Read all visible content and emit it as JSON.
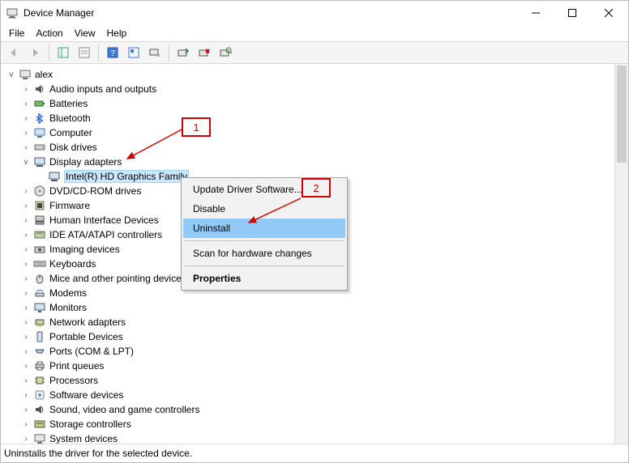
{
  "window": {
    "title": "Device Manager"
  },
  "menubar": {
    "items": [
      "File",
      "Action",
      "View",
      "Help"
    ]
  },
  "root": {
    "label": "alex"
  },
  "tree": [
    {
      "label": "Audio inputs and outputs"
    },
    {
      "label": "Batteries"
    },
    {
      "label": "Bluetooth"
    },
    {
      "label": "Computer"
    },
    {
      "label": "Disk drives"
    },
    {
      "label": "Display adapters"
    },
    {
      "label": "Intel(R) HD Graphics Family"
    },
    {
      "label": "DVD/CD-ROM drives"
    },
    {
      "label": "Firmware"
    },
    {
      "label": "Human Interface Devices"
    },
    {
      "label": "IDE ATA/ATAPI controllers"
    },
    {
      "label": "Imaging devices"
    },
    {
      "label": "Keyboards"
    },
    {
      "label": "Mice and other pointing devices"
    },
    {
      "label": "Modems"
    },
    {
      "label": "Monitors"
    },
    {
      "label": "Network adapters"
    },
    {
      "label": "Portable Devices"
    },
    {
      "label": "Ports (COM & LPT)"
    },
    {
      "label": "Print queues"
    },
    {
      "label": "Processors"
    },
    {
      "label": "Software devices"
    },
    {
      "label": "Sound, video and game controllers"
    },
    {
      "label": "Storage controllers"
    },
    {
      "label": "System devices"
    }
  ],
  "ctx": {
    "update": "Update Driver Software...",
    "disable": "Disable",
    "uninstall": "Uninstall",
    "scan": "Scan for hardware changes",
    "properties": "Properties"
  },
  "callouts": {
    "c1": "1",
    "c2": "2"
  },
  "status": {
    "text": "Uninstalls the driver for the selected device."
  }
}
